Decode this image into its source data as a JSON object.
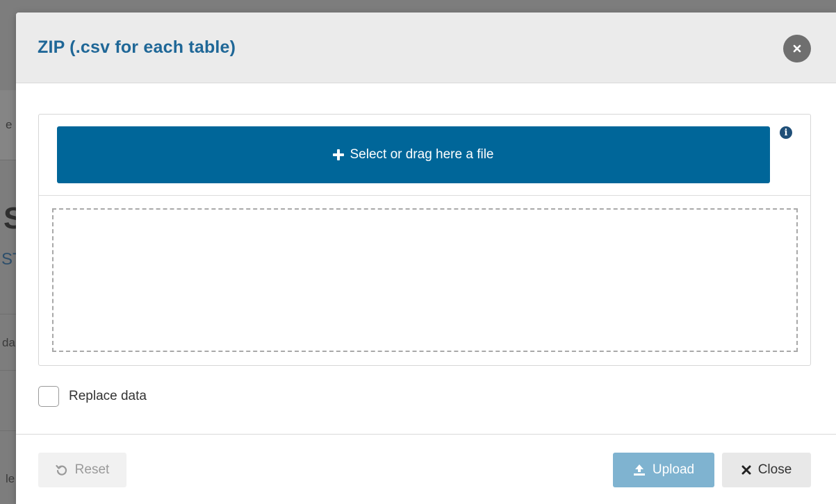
{
  "background": {
    "fragments": [
      "e",
      "S",
      "ST",
      "da",
      "le"
    ]
  },
  "modal": {
    "title": "ZIP (.csv for each table)",
    "close_icon": "close-circle-icon",
    "upload": {
      "select_label": "Select or drag here a file",
      "plus_icon": "plus-icon",
      "info_icon": "info-icon"
    },
    "replace_data_label": "Replace data",
    "replace_data_checked": false,
    "footer": {
      "reset_label": "Reset",
      "reset_icon": "undo-icon",
      "upload_label": "Upload",
      "upload_icon": "upload-icon",
      "close_label": "Close",
      "close_icon": "times-icon"
    }
  },
  "colors": {
    "title": "#1f6797",
    "primary": "#006699",
    "upload_disabled": "#7fb3d0"
  }
}
